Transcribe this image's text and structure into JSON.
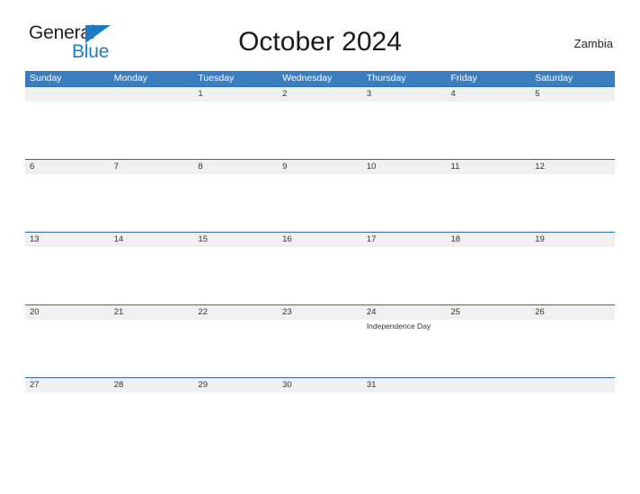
{
  "brand": {
    "name_part1": "General",
    "name_part2": "Blue",
    "flag_icon": "blue-triangle-flag-icon",
    "color_dark": "#231f20",
    "color_blue": "#1f7ac4"
  },
  "header": {
    "title": "October 2024",
    "country": "Zambia"
  },
  "calendar": {
    "accent_header_color": "#3a7ebf",
    "band_color": "#f0f0f0",
    "row_rule_color": "#2f6ea8",
    "weekdays": [
      "Sunday",
      "Monday",
      "Tuesday",
      "Wednesday",
      "Thursday",
      "Friday",
      "Saturday"
    ],
    "weeks": [
      {
        "days": [
          {
            "date": "",
            "event": ""
          },
          {
            "date": "",
            "event": ""
          },
          {
            "date": "1",
            "event": ""
          },
          {
            "date": "2",
            "event": ""
          },
          {
            "date": "3",
            "event": ""
          },
          {
            "date": "4",
            "event": ""
          },
          {
            "date": "5",
            "event": ""
          }
        ]
      },
      {
        "days": [
          {
            "date": "6",
            "event": ""
          },
          {
            "date": "7",
            "event": ""
          },
          {
            "date": "8",
            "event": ""
          },
          {
            "date": "9",
            "event": ""
          },
          {
            "date": "10",
            "event": ""
          },
          {
            "date": "11",
            "event": ""
          },
          {
            "date": "12",
            "event": ""
          }
        ]
      },
      {
        "days": [
          {
            "date": "13",
            "event": ""
          },
          {
            "date": "14",
            "event": ""
          },
          {
            "date": "15",
            "event": ""
          },
          {
            "date": "16",
            "event": ""
          },
          {
            "date": "17",
            "event": ""
          },
          {
            "date": "18",
            "event": ""
          },
          {
            "date": "19",
            "event": ""
          }
        ]
      },
      {
        "days": [
          {
            "date": "20",
            "event": ""
          },
          {
            "date": "21",
            "event": ""
          },
          {
            "date": "22",
            "event": ""
          },
          {
            "date": "23",
            "event": ""
          },
          {
            "date": "24",
            "event": "Independence Day"
          },
          {
            "date": "25",
            "event": ""
          },
          {
            "date": "26",
            "event": ""
          }
        ]
      },
      {
        "days": [
          {
            "date": "27",
            "event": ""
          },
          {
            "date": "28",
            "event": ""
          },
          {
            "date": "29",
            "event": ""
          },
          {
            "date": "30",
            "event": ""
          },
          {
            "date": "31",
            "event": ""
          },
          {
            "date": "",
            "event": ""
          },
          {
            "date": "",
            "event": ""
          }
        ]
      }
    ]
  }
}
